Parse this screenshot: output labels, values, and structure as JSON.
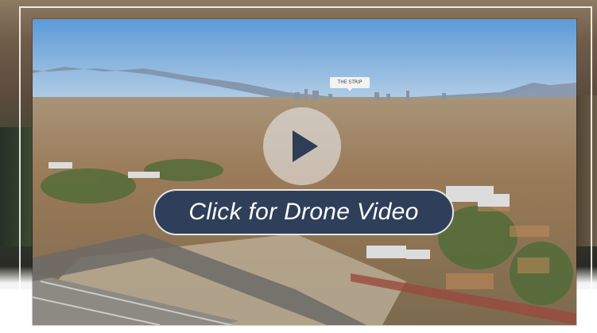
{
  "video_player": {
    "cta_label": "Click for Drone Video",
    "landmark_label": "THE STRIP",
    "icon": "play-icon"
  },
  "colors": {
    "cta_background": "#2f3f5a",
    "play_triangle": "#2f3d56",
    "frame_border": "#ffffff"
  }
}
